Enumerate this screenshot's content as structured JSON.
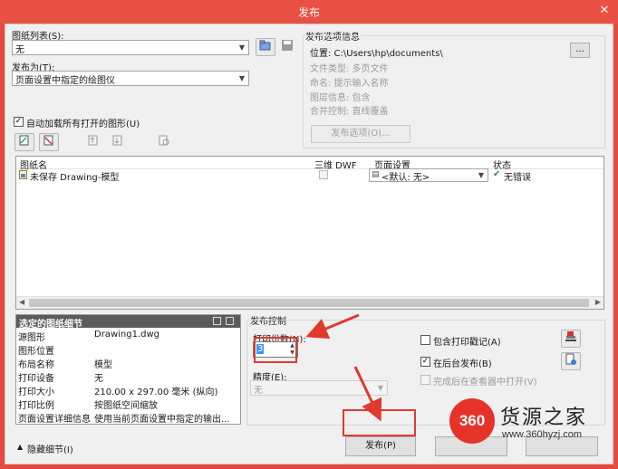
{
  "window": {
    "title": "发布",
    "close_glyph": "✕"
  },
  "left": {
    "sheet_list_label": "图纸列表(S):",
    "sheet_list_value": "无",
    "publish_to_label": "发布为(T):",
    "publish_to_value": "页面设置中指定的绘图仪",
    "auto_load_label": "自动加载所有打开的图形(U)",
    "auto_load_checked": true
  },
  "publish_options": {
    "group_label": "发布选项信息",
    "location": "位置: C:\\Users\\hp\\documents\\",
    "browse_label": "...",
    "file_type": "文件类型: 多页文件",
    "naming": "命名: 提示输入名称",
    "layer_info": "图层信息: 包含",
    "merge_control": "合并控制: 直线覆盖",
    "options_button": "发布选项(O)..."
  },
  "table": {
    "headers": {
      "sheet_name": "图纸名",
      "3d_dwf": "三维 DWF",
      "page_setup": "页面设置",
      "status": "状态"
    },
    "rows": [
      {
        "sheet_name": "未保存 Drawing-模型",
        "page_setup": "<默认: 无>",
        "status": "无错误"
      }
    ]
  },
  "details": {
    "title": "选定的图纸细节",
    "rows": [
      {
        "key": "源图形",
        "value": "Drawing1.dwg"
      },
      {
        "key": "图形位置",
        "value": ""
      },
      {
        "key": "布局名称",
        "value": "模型"
      },
      {
        "key": "打印设备",
        "value": "无"
      },
      {
        "key": "打印大小",
        "value": "210.00 x 297.00 毫米 (纵向)"
      },
      {
        "key": "打印比例",
        "value": "按图纸空间缩放"
      },
      {
        "key": "页面设置详细信息",
        "value": "使用当前页面设置中指定的输出..."
      }
    ]
  },
  "publish_control": {
    "group_label": "发布控制",
    "copies_label": "打印份数(N):",
    "copies_value": "3",
    "precision_label": "精度(E):",
    "precision_value": "无",
    "include_stamp_label": "包含打印戳记(A)",
    "include_stamp_checked": false,
    "background_label": "在后台发布(B)",
    "background_checked": true,
    "open_viewer_label": "完成后在查看器中打开(V)",
    "open_viewer_checked": false
  },
  "footer": {
    "hide_details_label": "隐藏细节(I)",
    "publish_button": "发布(P)"
  },
  "watermark": {
    "badge": "360",
    "text": "货源之家",
    "url": "www.360hyzj.com"
  },
  "colors": {
    "title_bar": "#ea4f43",
    "annotation_red": "#e03a2f",
    "selection_blue": "#3399ff"
  }
}
